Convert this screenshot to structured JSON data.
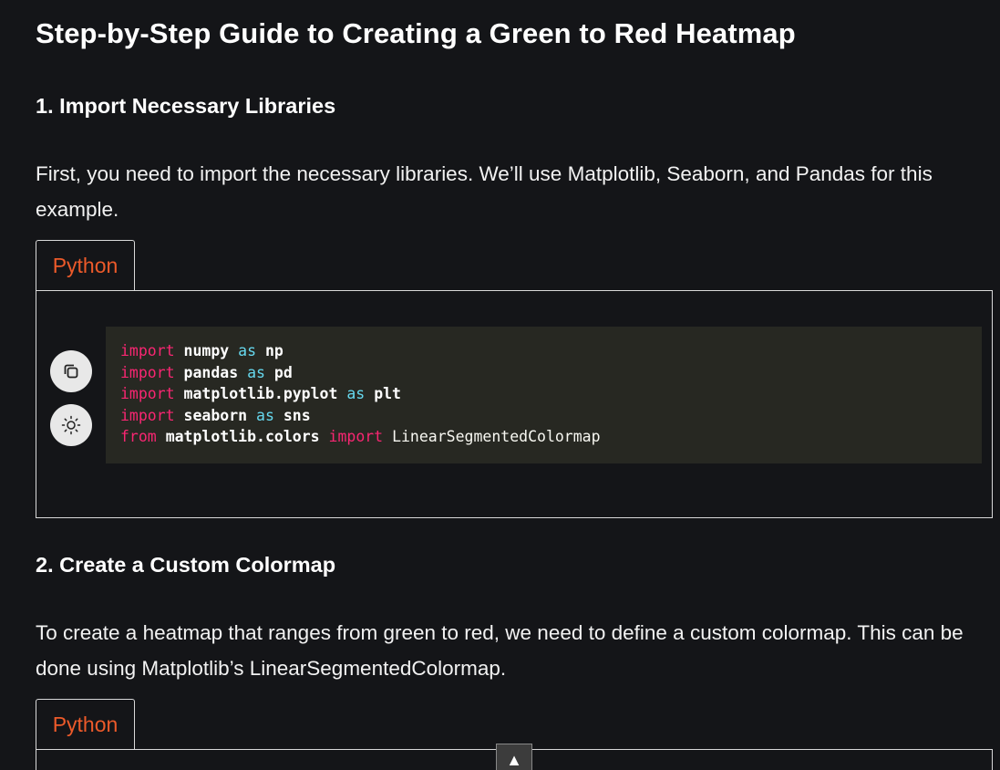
{
  "article": {
    "title": "Step-by-Step Guide to Creating a Green to Red Heatmap",
    "sections": [
      {
        "heading": "1. Import Necessary Libraries",
        "paragraph": "First, you need to import the necessary libraries. We’ll use Matplotlib, Seaborn, and Pandas for this example.",
        "code_tab": "Python",
        "code_lines": [
          [
            [
              "import",
              "kw"
            ],
            [
              " ",
              "pl"
            ],
            [
              "numpy",
              "nm"
            ],
            [
              " ",
              "pl"
            ],
            [
              "as",
              "kw2"
            ],
            [
              " ",
              "pl"
            ],
            [
              "np",
              "nm"
            ]
          ],
          [
            [
              "import",
              "kw"
            ],
            [
              " ",
              "pl"
            ],
            [
              "pandas",
              "nm"
            ],
            [
              " ",
              "pl"
            ],
            [
              "as",
              "kw2"
            ],
            [
              " ",
              "pl"
            ],
            [
              "pd",
              "nm"
            ]
          ],
          [
            [
              "import",
              "kw"
            ],
            [
              " ",
              "pl"
            ],
            [
              "matplotlib.pyplot",
              "nm"
            ],
            [
              " ",
              "pl"
            ],
            [
              "as",
              "kw2"
            ],
            [
              " ",
              "pl"
            ],
            [
              "plt",
              "nm"
            ]
          ],
          [
            [
              "import",
              "kw"
            ],
            [
              " ",
              "pl"
            ],
            [
              "seaborn",
              "nm"
            ],
            [
              " ",
              "pl"
            ],
            [
              "as",
              "kw2"
            ],
            [
              " ",
              "pl"
            ],
            [
              "sns",
              "nm"
            ]
          ],
          [
            [
              "from",
              "kw"
            ],
            [
              " ",
              "pl"
            ],
            [
              "matplotlib.colors",
              "nm"
            ],
            [
              " ",
              "pl"
            ],
            [
              "import",
              "kw"
            ],
            [
              " ",
              "pl"
            ],
            [
              "LinearSegmentedColormap",
              "pl"
            ]
          ]
        ]
      },
      {
        "heading": "2. Create a Custom Colormap",
        "paragraph": "To create a heatmap that ranges from green to red, we need to define a custom colormap. This can be done using Matplotlib’s LinearSegmentedColormap.",
        "code_tab": "Python"
      }
    ]
  },
  "icons": {
    "copy": "copy-icon",
    "theme": "sun-icon",
    "scroll_top": "chevron-up-icon"
  },
  "scroll_top_glyph": "▲",
  "colors": {
    "background": "#141518",
    "tab_text": "#ec5a2a",
    "code_bg": "#272822",
    "keyword": "#f92672",
    "keyword_as": "#66d9ef"
  }
}
